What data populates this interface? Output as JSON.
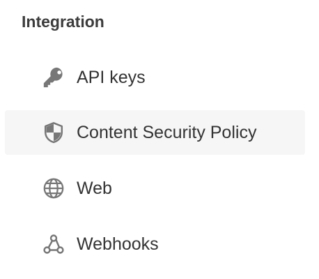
{
  "section": {
    "heading": "Integration",
    "items": [
      {
        "label": "API keys",
        "icon": "key-icon",
        "active": false
      },
      {
        "label": "Content Security Policy",
        "icon": "shield-icon",
        "active": true
      },
      {
        "label": "Web",
        "icon": "globe-icon",
        "active": false
      },
      {
        "label": "Webhooks",
        "icon": "webhook-icon",
        "active": false
      }
    ]
  },
  "colors": {
    "heading": "#3c3c3c",
    "label": "#333333",
    "icon": "#777777",
    "active_background": "#f6f6f6"
  }
}
